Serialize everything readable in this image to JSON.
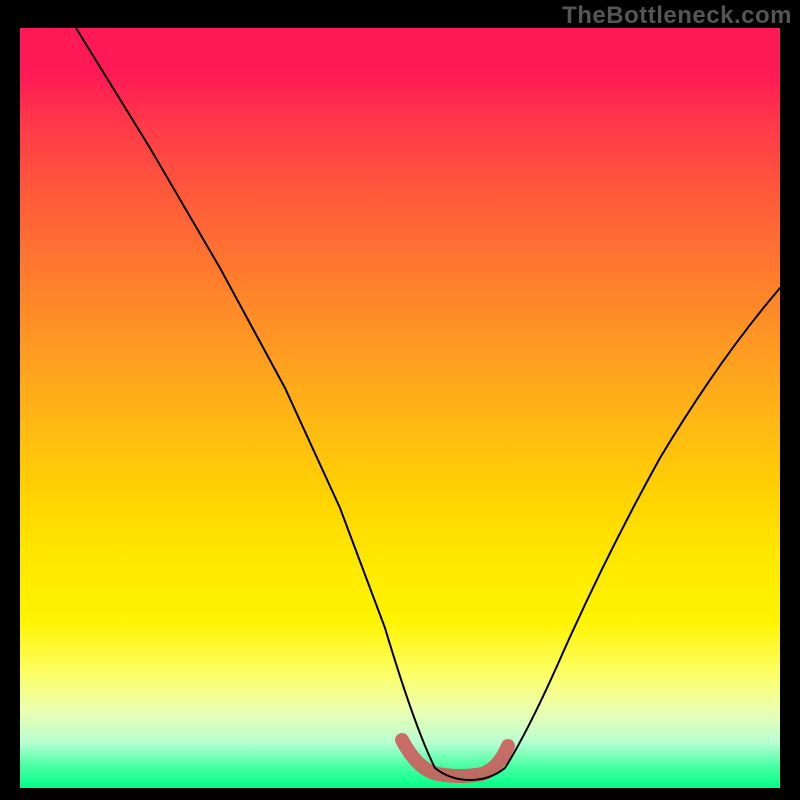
{
  "watermark": "TheBottleneck.com",
  "colors": {
    "bg": "#000000",
    "frame": "#000000",
    "highlight": "#cd5c5c",
    "curve": "#000000",
    "gradient_top": "#ff1956",
    "gradient_bottom": "#00ff88"
  },
  "chart_data": {
    "type": "line",
    "title": "",
    "xlabel": "",
    "ylabel": "",
    "xlim": [
      0,
      100
    ],
    "ylim": [
      0,
      100
    ],
    "grid": false,
    "legend": false,
    "note": "Stylized bottleneck V-curve over rainbow gradient. y is percent bottleneck (0 at valley, 100 at top). Values estimated from pixel rendering.",
    "x": [
      0,
      5,
      10,
      15,
      20,
      25,
      30,
      35,
      40,
      45,
      48,
      50,
      53,
      56,
      58,
      60,
      63,
      66,
      70,
      75,
      80,
      85,
      90,
      95,
      100
    ],
    "y": [
      100,
      92,
      83,
      74,
      65,
      56,
      47,
      38,
      28,
      17,
      9,
      5,
      1,
      0,
      0,
      0,
      1,
      4,
      9,
      16,
      25,
      34,
      44,
      53,
      62
    ],
    "highlight_region": {
      "x_start": 50,
      "x_end": 63
    }
  }
}
